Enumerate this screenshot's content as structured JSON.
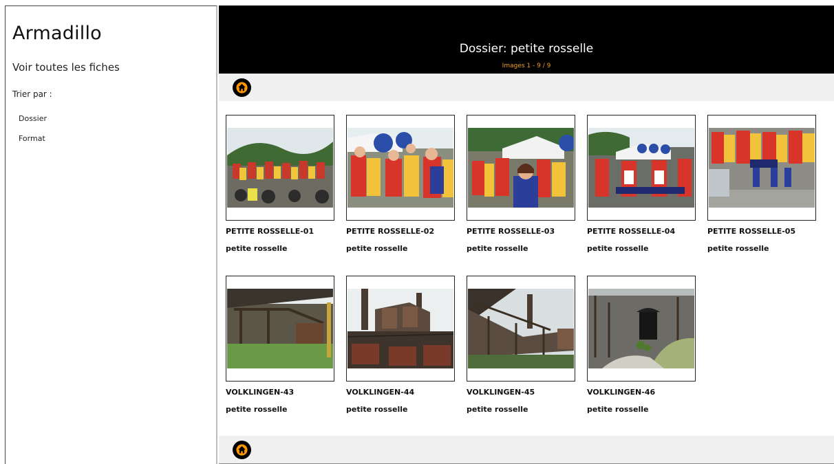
{
  "sidebar": {
    "brand": "Armadillo",
    "all_link": "Voir toutes les fiches",
    "sort_label": "Trier par :",
    "sort_items": [
      "Dossier",
      "Format"
    ]
  },
  "header": {
    "title": "Dossier: petite rosselle",
    "subtitle": "Images 1 - 9 / 9"
  },
  "colors": {
    "header_bg": "#000000",
    "accent": "#f0a11a",
    "home_icon": "#ff9800",
    "toolbar_bg": "#f0f0f0"
  },
  "icons": {
    "home": "home-icon"
  },
  "images": [
    {
      "title": "PETITE ROSSELLE-01",
      "folder": "petite rosselle"
    },
    {
      "title": "PETITE ROSSELLE-02",
      "folder": "petite rosselle"
    },
    {
      "title": "PETITE ROSSELLE-03",
      "folder": "petite rosselle"
    },
    {
      "title": "PETITE ROSSELLE-04",
      "folder": "petite rosselle"
    },
    {
      "title": "PETITE ROSSELLE-05",
      "folder": "petite rosselle"
    },
    {
      "title": "VOLKLINGEN-43",
      "folder": "petite rosselle"
    },
    {
      "title": "VOLKLINGEN-44",
      "folder": "petite rosselle"
    },
    {
      "title": "VOLKLINGEN-45",
      "folder": "petite rosselle"
    },
    {
      "title": "VOLKLINGEN-46",
      "folder": "petite rosselle"
    }
  ]
}
